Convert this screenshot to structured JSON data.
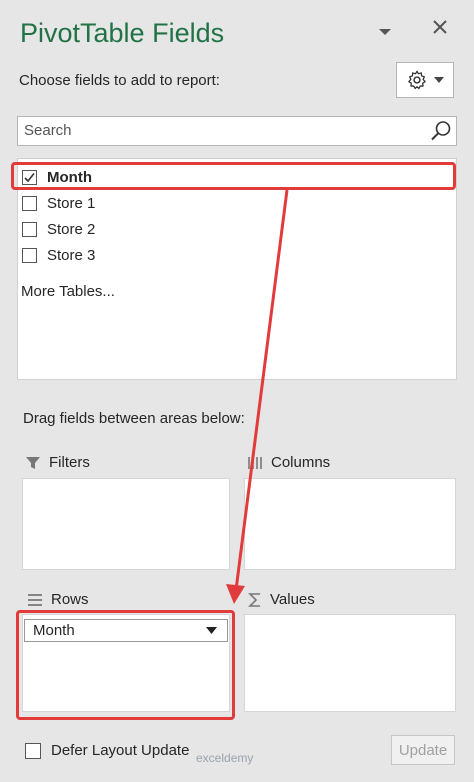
{
  "panel": {
    "title": "PivotTable Fields",
    "choose_label": "Choose fields to add to report:",
    "search_placeholder": "Search",
    "fields": [
      {
        "label": "Month",
        "checked": true
      },
      {
        "label": "Store 1",
        "checked": false
      },
      {
        "label": "Store 2",
        "checked": false
      },
      {
        "label": "Store 3",
        "checked": false
      }
    ],
    "more_tables": "More Tables...",
    "drag_label": "Drag fields between areas below:"
  },
  "areas": {
    "filters": "Filters",
    "columns": "Columns",
    "rows": "Rows",
    "values": "Values",
    "row_items": [
      "Month"
    ]
  },
  "footer": {
    "defer_label": "Defer Layout Update",
    "update_label": "Update"
  },
  "watermark": "exceldemy",
  "colors": {
    "title": "#217346",
    "annotation": "#e23b3b",
    "panel_bg": "#e6e6e6"
  }
}
